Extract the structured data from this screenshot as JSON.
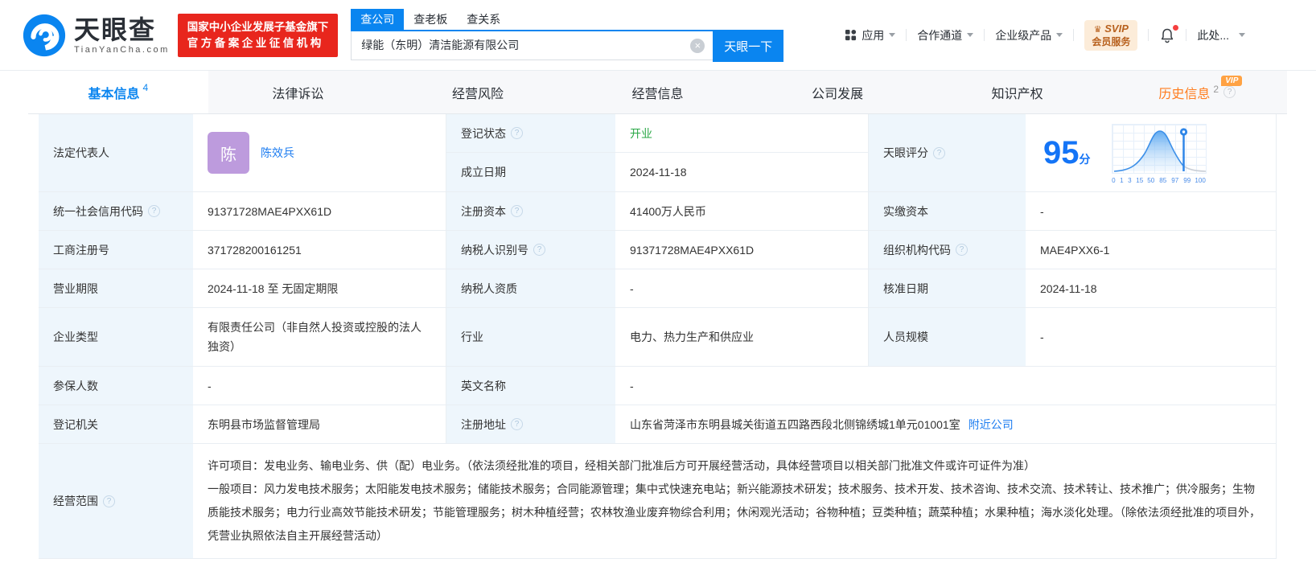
{
  "colors": {
    "brand_blue": "#0a85f0",
    "badge_red": "#e8261d",
    "status_green": "#2aa846",
    "history_orange": "#ff7d1f",
    "score_blue": "#1474f6",
    "avatar_purple": "#bd9bdd"
  },
  "header": {
    "logo": {
      "brand": "天眼查",
      "domain": "TianYanCha.com"
    },
    "badge": {
      "line1": "国家中小企业发展子基金旗下",
      "line2": "官方备案企业征信机构"
    },
    "search": {
      "tabs": [
        {
          "label": "查公司",
          "active": true
        },
        {
          "label": "查老板",
          "active": false
        },
        {
          "label": "查关系",
          "active": false
        }
      ],
      "value": "绿能（东明）清洁能源有限公司",
      "button": "天眼一下"
    },
    "menu": {
      "apps": "应用",
      "cooperation": "合作通道",
      "enterprise_products": "企业级产品",
      "svip_title": "SVIP",
      "svip_subtitle": "会员服务",
      "more": "此处..."
    }
  },
  "tabs": [
    {
      "label": "基本信息",
      "count": "4"
    },
    {
      "label": "法律诉讼"
    },
    {
      "label": "经营风险"
    },
    {
      "label": "经营信息"
    },
    {
      "label": "公司发展"
    },
    {
      "label": "知识产权"
    },
    {
      "label": "历史信息",
      "count": "2",
      "vip_label": "VIP"
    }
  ],
  "info": {
    "legal_rep": {
      "label": "法定代表人",
      "avatar_text": "陈",
      "name": "陈效兵"
    },
    "reg_status": {
      "label": "登记状态",
      "value": "开业"
    },
    "est_date": {
      "label": "成立日期",
      "value": "2024-11-18"
    },
    "score": {
      "label": "天眼评分",
      "value": "95",
      "unit": "分",
      "ticks": [
        "0",
        "1",
        "3",
        "15",
        "50",
        "85",
        "97",
        "99",
        "100"
      ]
    },
    "credit_code": {
      "label": "统一社会信用代码",
      "value": "91371728MAE4PXX61D"
    },
    "reg_capital": {
      "label": "注册资本",
      "value": "41400万人民币"
    },
    "paid_capital": {
      "label": "实缴资本",
      "value": "-"
    },
    "reg_number": {
      "label": "工商注册号",
      "value": "371728200161251"
    },
    "taxpayer_id": {
      "label": "纳税人识别号",
      "value": "91371728MAE4PXX61D"
    },
    "org_code": {
      "label": "组织机构代码",
      "value": "MAE4PXX6-1"
    },
    "business_term": {
      "label": "营业期限",
      "value": "2024-11-18 至 无固定期限"
    },
    "taxpayer_qualification": {
      "label": "纳税人资质",
      "value": "-"
    },
    "approval_date": {
      "label": "核准日期",
      "value": "2024-11-18"
    },
    "company_type": {
      "label": "企业类型",
      "value": "有限责任公司（非自然人投资或控股的法人独资）"
    },
    "industry": {
      "label": "行业",
      "value": "电力、热力生产和供应业"
    },
    "staff_size": {
      "label": "人员规模",
      "value": "-"
    },
    "insured_count": {
      "label": "参保人数",
      "value": "-"
    },
    "english_name": {
      "label": "英文名称",
      "value": "-"
    },
    "reg_authority": {
      "label": "登记机关",
      "value": "东明县市场监督管理局"
    },
    "reg_address": {
      "label": "注册地址",
      "value": "山东省菏泽市东明县城关街道五四路西段北侧锦绣城1单元01001室",
      "link": "附近公司"
    },
    "business_scope": {
      "label": "经营范围",
      "value": "许可项目：发电业务、输电业务、供（配）电业务。（依法须经批准的项目，经相关部门批准后方可开展经营活动，具体经营项目以相关部门批准文件或许可证件为准）\n一般项目：风力发电技术服务；太阳能发电技术服务；储能技术服务；合同能源管理；集中式快速充电站；新兴能源技术研发；技术服务、技术开发、技术咨询、技术交流、技术转让、技术推广；供冷服务；生物质能技术服务；电力行业高效节能技术研发；节能管理服务；树木种植经营；农林牧渔业废弃物综合利用；休闲观光活动；谷物种植；豆类种植；蔬菜种植；水果种植；海水淡化处理。（除依法须经批准的项目外，凭营业执照依法自主开展经营活动）"
    }
  },
  "chart_data": {
    "type": "area",
    "title": "天眼评分百分位分布",
    "x_ticks": [
      0,
      1,
      3,
      15,
      50,
      85,
      97,
      99,
      100
    ],
    "shape": "bell-curve",
    "peak_tick": 50,
    "marker_tick": 97,
    "score_value": 95
  }
}
